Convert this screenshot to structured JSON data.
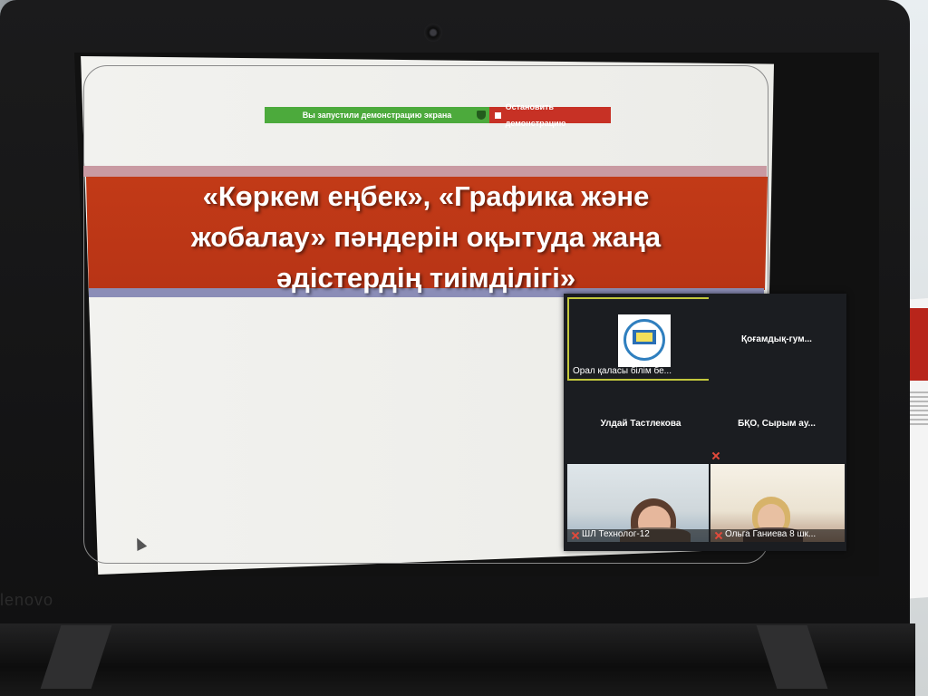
{
  "laptop": {
    "brand": "lenovo"
  },
  "screen_share_bar": {
    "status_text": "Вы запустили демонстрацию экрана",
    "stop_label": "Остановить демонстрацию"
  },
  "slide": {
    "title_lines": [
      "«Көркем еңбек», «Графика және",
      "жобалау» пәндерін оқытуда жаңа",
      "әдістердің тиімділігі»"
    ]
  },
  "gallery": {
    "tiles": [
      {
        "name": "Орал қаласы білім бе...",
        "active": true
      },
      {
        "name": "Қоғамдық-гум..."
      },
      {
        "name": "Улдай Тастлекова"
      },
      {
        "name": "БҚО, Сырым ау..."
      },
      {
        "name": "ШЛ Технолог-12"
      },
      {
        "name": "Ольга Ганиева 8 шк..."
      }
    ]
  },
  "colors": {
    "share_green": "#4caa3c",
    "share_red": "#c73125",
    "title_band": "#c23a17",
    "active_tile_border": "#c3c83c"
  }
}
